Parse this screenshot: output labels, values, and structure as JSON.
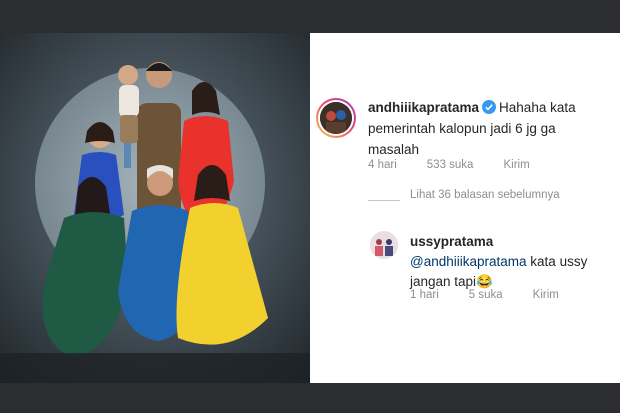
{
  "comment": {
    "username": "andhiiikapratama",
    "text": "Hahaha kata pemerintah kalopun jadi 6 jg ga masalah",
    "time": "4 hari",
    "likes": "533 suka",
    "reply_label": "Kirim"
  },
  "view_replies": "Lihat 36 balasan sebelumnya",
  "reply": {
    "username": "ussypratama",
    "mention": "@andhiiikapratama",
    "text": "kata ussy jangan tapi😂",
    "time": "1 hari",
    "likes": "5 suka",
    "reply_label": "Kirim"
  },
  "colors": {
    "verified": "#3897f0",
    "mention": "#00376b",
    "meta": "#8e8e8e"
  }
}
